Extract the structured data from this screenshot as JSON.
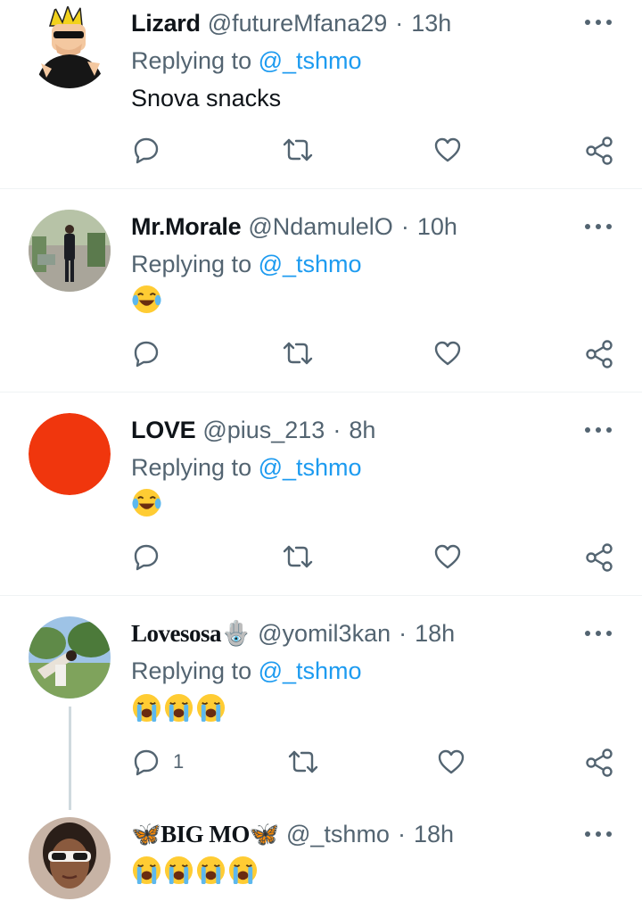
{
  "replying_prefix": "Replying to",
  "tweets": [
    {
      "name": "Lizard",
      "handle": "@futureMfana29",
      "sep": "·",
      "time": "13h",
      "replying_to": "@_tshmo",
      "text": "Snova snacks",
      "reply_count": "",
      "avatar": "cartoon-character"
    },
    {
      "name": "Mr.Morale",
      "handle": "@NdamulelO",
      "sep": "·",
      "time": "10h",
      "replying_to": "@_tshmo",
      "emojis": [
        "😂"
      ],
      "reply_count": "",
      "avatar": "man-in-suit-photo"
    },
    {
      "name": "LOVE",
      "handle": "@pius_213",
      "sep": "·",
      "time": "8h",
      "replying_to": "@_tshmo",
      "emojis": [
        "😂"
      ],
      "reply_count": "",
      "avatar": "red-circle"
    },
    {
      "name": "Lovesosa🪬",
      "handle": "@yomil3kan",
      "sep": "·",
      "time": "18h",
      "replying_to": "@_tshmo",
      "emojis": [
        "😭",
        "😭",
        "😭"
      ],
      "reply_count": "1",
      "avatar": "outdoor-photo"
    },
    {
      "name": "🦋BIG MO🦋",
      "handle": "@_tshmo",
      "sep": "·",
      "time": "18h",
      "emojis": [
        "😭",
        "😭",
        "😭",
        "😭"
      ],
      "avatar": "woman-with-sunglasses-photo"
    }
  ],
  "colors": {
    "link": "#1d9bf0",
    "secondary_text": "#536471",
    "primary_text": "#0f1419",
    "divider": "#eff3f4",
    "thread_line": "#cfd9de",
    "red_avatar": "#f0360d"
  },
  "icons": [
    "more-icon",
    "reply-icon",
    "retweet-icon",
    "like-icon",
    "share-icon"
  ]
}
